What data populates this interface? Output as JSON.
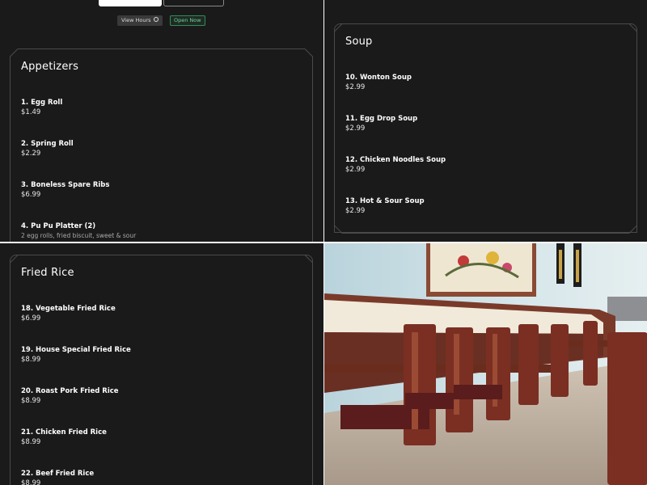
{
  "header": {
    "view_hours_label": "View Hours",
    "view_hours_icon": "clock-icon",
    "open_status": "Open Now",
    "status_color": "#6fd39a"
  },
  "appetizers": {
    "title": "Appetizers",
    "items": [
      {
        "name": "1. Egg Roll",
        "price": "$1.49"
      },
      {
        "name": "2. Spring Roll",
        "price": "$2.29"
      },
      {
        "name": "3. Boneless Spare Ribs",
        "price": "$6.99"
      },
      {
        "name": "4. Pu Pu Platter (2)",
        "desc": "2 egg rolls, fried biscuit, sweet & sour"
      }
    ]
  },
  "soup": {
    "title": "Soup",
    "items": [
      {
        "name": "10. Wonton Soup",
        "price": "$2.99"
      },
      {
        "name": "11. Egg Drop Soup",
        "price": "$2.99"
      },
      {
        "name": "12. Chicken Noodles Soup",
        "price": "$2.99"
      },
      {
        "name": "13. Hot & Sour Soup",
        "price": "$2.99"
      }
    ]
  },
  "fried_rice": {
    "title": "Fried Rice",
    "items": [
      {
        "name": "18. Vegetable Fried Rice",
        "price": "$6.99"
      },
      {
        "name": "19. House Special Fried Rice",
        "price": "$8.99"
      },
      {
        "name": "20. Roast Pork Fried Rice",
        "price": "$8.99"
      },
      {
        "name": "21. Chicken Fried Rice",
        "price": "$8.99"
      },
      {
        "name": "22. Beef Fried Rice",
        "price": "$8.99"
      }
    ]
  },
  "theme": {
    "background": "#1b1a1b",
    "card_border": "#4a4a4a",
    "text": "#ffffff"
  }
}
